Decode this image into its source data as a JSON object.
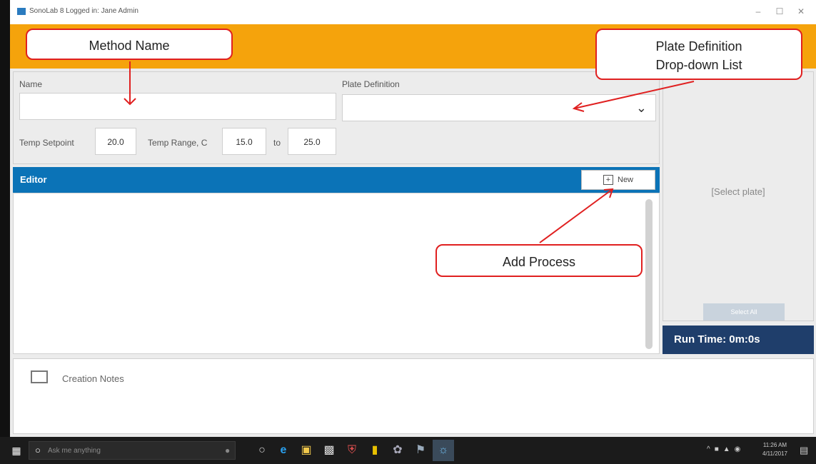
{
  "window": {
    "title": "SonoLab 8 Logged in: Jane Admin",
    "min_glyph": "–",
    "max_glyph": "☐",
    "close_glyph": "✕"
  },
  "form": {
    "name_label": "Name",
    "name_value": "",
    "plate_label": "Plate Definition",
    "plate_value": "",
    "temp_setpoint_label": "Temp Setpoint",
    "temp_setpoint_value": "20.0",
    "temp_range_label": "Temp Range, C",
    "temp_range_min": "15.0",
    "to_label": "to",
    "temp_range_max": "25.0"
  },
  "editor": {
    "title": "Editor",
    "new_button_label": "New",
    "new_icon_glyph": "+"
  },
  "right_panel": {
    "placeholder": "[Select plate]",
    "select_all_label": "Select All",
    "run_time": "Run Time: 0m:0s"
  },
  "notes": {
    "label": "Creation Notes"
  },
  "callouts": {
    "method_name": "Method Name",
    "plate_definition_line1": "Plate Definition",
    "plate_definition_line2": "Drop-down List",
    "add_process": "Add Process"
  },
  "taskbar": {
    "search_placeholder": "Ask me anything",
    "time": "11:26 AM",
    "date": "4/11/2017"
  },
  "colors": {
    "orange_bar": "#f5a30c",
    "editor_header": "#0b73b7",
    "runtime_bar": "#1f3e6b",
    "callout_border": "#e02020"
  }
}
